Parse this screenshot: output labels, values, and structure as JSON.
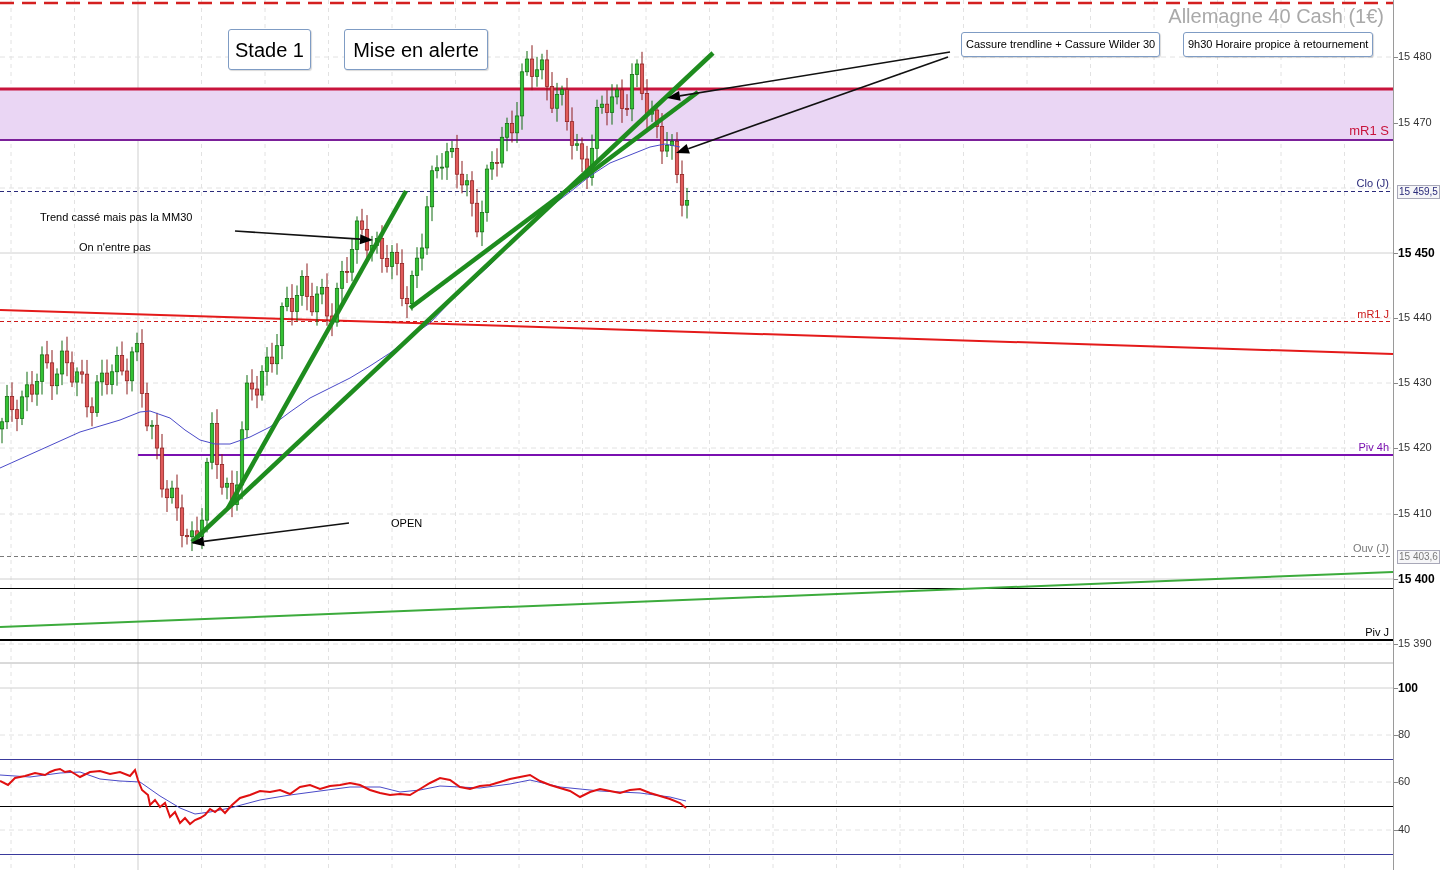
{
  "chart": {
    "title": "Allemagne 40 Cash (1€)"
  },
  "notes": [
    {
      "kind": "box_large",
      "text": "Stade 1"
    },
    {
      "kind": "box_large",
      "text": "Mise en alerte"
    },
    {
      "kind": "box",
      "text": "Cassure trendline + Cassure Wilder 30"
    },
    {
      "kind": "box",
      "text": "9h30 Horaire propice à retournement"
    },
    {
      "kind": "plain",
      "text": "Trend cassé mais pas la MM30"
    },
    {
      "kind": "plain",
      "text": "On n'entre pas"
    },
    {
      "kind": "plain",
      "text": "OPEN"
    }
  ],
  "levels": [
    {
      "kind": "band",
      "label": "mR1 S",
      "color": "#c8143c"
    },
    {
      "kind": "dashed",
      "label": "Clo (J)",
      "color": "#2a2a7a",
      "price_tag": "15 459,5"
    },
    {
      "kind": "dashed",
      "label": "mR1 J",
      "color": "#cc1a1a"
    },
    {
      "kind": "solid",
      "label": "Piv 4h",
      "color": "#7a10b0"
    },
    {
      "kind": "dashed",
      "label": "Ouv (J)",
      "color": "#7a7a7a",
      "price_tag": "15 403,6"
    },
    {
      "kind": "solid",
      "label": "Piv J",
      "color": "#000000"
    }
  ],
  "price_axis": {
    "ticks": [
      {
        "label": "15 480",
        "major": false
      },
      {
        "label": "15 470",
        "major": false
      },
      {
        "label": "15 450",
        "major": true
      },
      {
        "label": "15 440",
        "major": false
      },
      {
        "label": "15 430",
        "major": false
      },
      {
        "label": "15 420",
        "major": false
      },
      {
        "label": "15 410",
        "major": false
      },
      {
        "label": "15 400",
        "major": true
      },
      {
        "label": "15 390",
        "major": false
      }
    ]
  },
  "indicator_axis": {
    "ticks": [
      {
        "label": "100",
        "major": true
      },
      {
        "label": "80",
        "major": false
      },
      {
        "label": "60",
        "major": false
      },
      {
        "label": "40",
        "major": false
      }
    ]
  }
}
